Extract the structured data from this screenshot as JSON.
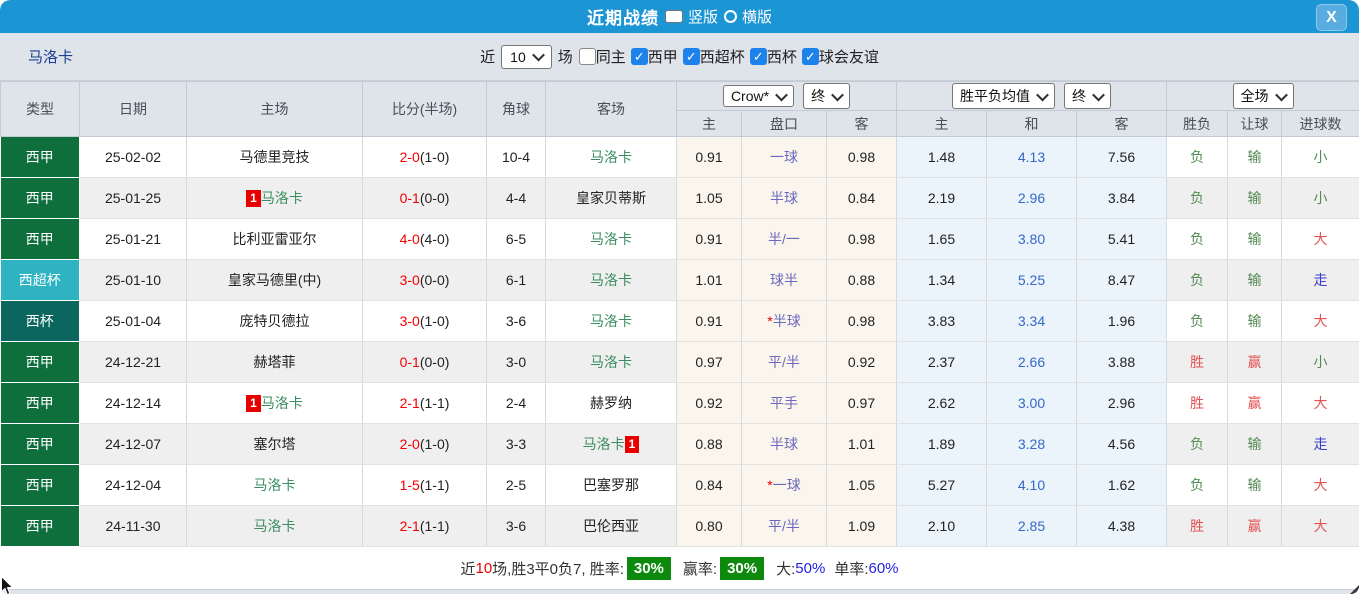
{
  "titlebar": {
    "title": "近期战绩",
    "view_options": [
      {
        "label": "竖版",
        "selected": true
      },
      {
        "label": "横版",
        "selected": false
      }
    ],
    "close_label": "X"
  },
  "filterbar": {
    "team": "马洛卡",
    "recent_label": "近",
    "recent_value": "10",
    "matches_label": "场",
    "filters": [
      {
        "label": "同主",
        "checked": false
      },
      {
        "label": "西甲",
        "checked": true
      },
      {
        "label": "西超杯",
        "checked": true
      },
      {
        "label": "西杯",
        "checked": true
      },
      {
        "label": "球会友谊",
        "checked": true
      }
    ]
  },
  "table": {
    "columns": [
      "类型",
      "日期",
      "主场",
      "比分(半场)",
      "角球",
      "客场"
    ],
    "selects": {
      "odds_company": "Crow*",
      "odds_time": "终",
      "avg_name": "胜平负均值",
      "avg_time": "终",
      "scope": "全场"
    },
    "sub_columns": [
      "主",
      "盘口",
      "客",
      "主",
      "和",
      "客",
      "胜负",
      "让球",
      "进球数"
    ],
    "rows": [
      {
        "league": "西甲",
        "date": "25-02-02",
        "home": {
          "name": "马德里竞技",
          "focus": false,
          "badge": null,
          "badge_after": false
        },
        "score": "2-0",
        "half": "(1-0)",
        "corners": "10-4",
        "away": {
          "name": "马洛卡",
          "focus": true,
          "badge": null,
          "badge_after": false
        },
        "crow": {
          "home": "0.91",
          "handicap": "一球",
          "star": false,
          "away": "0.98"
        },
        "avg": {
          "home": "1.48",
          "draw": "4.13",
          "away": "7.56"
        },
        "verdict": {
          "result": "负",
          "handicap": "输",
          "goals": "小"
        }
      },
      {
        "league": "西甲",
        "date": "25-01-25",
        "home": {
          "name": "马洛卡",
          "focus": true,
          "badge": "1",
          "badge_after": false
        },
        "score": "0-1",
        "half": "(0-0)",
        "corners": "4-4",
        "away": {
          "name": "皇家贝蒂斯",
          "focus": false,
          "badge": null,
          "badge_after": false
        },
        "crow": {
          "home": "1.05",
          "handicap": "半球",
          "star": false,
          "away": "0.84"
        },
        "avg": {
          "home": "2.19",
          "draw": "2.96",
          "away": "3.84"
        },
        "verdict": {
          "result": "负",
          "handicap": "输",
          "goals": "小"
        }
      },
      {
        "league": "西甲",
        "date": "25-01-21",
        "home": {
          "name": "比利亚雷亚尔",
          "focus": false,
          "badge": null,
          "badge_after": false
        },
        "score": "4-0",
        "half": "(4-0)",
        "corners": "6-5",
        "away": {
          "name": "马洛卡",
          "focus": true,
          "badge": null,
          "badge_after": false
        },
        "crow": {
          "home": "0.91",
          "handicap": "半/一",
          "star": false,
          "away": "0.98"
        },
        "avg": {
          "home": "1.65",
          "draw": "3.80",
          "away": "5.41"
        },
        "verdict": {
          "result": "负",
          "handicap": "输",
          "goals": "大"
        }
      },
      {
        "league": "西超杯",
        "date": "25-01-10",
        "home": {
          "name": "皇家马德里(中)",
          "focus": false,
          "badge": null,
          "badge_after": false
        },
        "score": "3-0",
        "half": "(0-0)",
        "corners": "6-1",
        "away": {
          "name": "马洛卡",
          "focus": true,
          "badge": null,
          "badge_after": false
        },
        "crow": {
          "home": "1.01",
          "handicap": "球半",
          "star": false,
          "away": "0.88"
        },
        "avg": {
          "home": "1.34",
          "draw": "5.25",
          "away": "8.47"
        },
        "verdict": {
          "result": "负",
          "handicap": "输",
          "goals": "走"
        }
      },
      {
        "league": "西杯",
        "date": "25-01-04",
        "home": {
          "name": "庞特贝德拉",
          "focus": false,
          "badge": null,
          "badge_after": false
        },
        "score": "3-0",
        "half": "(1-0)",
        "corners": "3-6",
        "away": {
          "name": "马洛卡",
          "focus": true,
          "badge": null,
          "badge_after": false
        },
        "crow": {
          "home": "0.91",
          "handicap": "半球",
          "star": true,
          "away": "0.98"
        },
        "avg": {
          "home": "3.83",
          "draw": "3.34",
          "away": "1.96"
        },
        "verdict": {
          "result": "负",
          "handicap": "输",
          "goals": "大"
        }
      },
      {
        "league": "西甲",
        "date": "24-12-21",
        "home": {
          "name": "赫塔菲",
          "focus": false,
          "badge": null,
          "badge_after": false
        },
        "score": "0-1",
        "half": "(0-0)",
        "corners": "3-0",
        "away": {
          "name": "马洛卡",
          "focus": true,
          "badge": null,
          "badge_after": false
        },
        "crow": {
          "home": "0.97",
          "handicap": "平/半",
          "star": false,
          "away": "0.92"
        },
        "avg": {
          "home": "2.37",
          "draw": "2.66",
          "away": "3.88"
        },
        "verdict": {
          "result": "胜",
          "handicap": "赢",
          "goals": "小"
        }
      },
      {
        "league": "西甲",
        "date": "24-12-14",
        "home": {
          "name": "马洛卡",
          "focus": true,
          "badge": "1",
          "badge_after": false
        },
        "score": "2-1",
        "half": "(1-1)",
        "corners": "2-4",
        "away": {
          "name": "赫罗纳",
          "focus": false,
          "badge": null,
          "badge_after": false
        },
        "crow": {
          "home": "0.92",
          "handicap": "平手",
          "star": false,
          "away": "0.97"
        },
        "avg": {
          "home": "2.62",
          "draw": "3.00",
          "away": "2.96"
        },
        "verdict": {
          "result": "胜",
          "handicap": "赢",
          "goals": "大"
        }
      },
      {
        "league": "西甲",
        "date": "24-12-07",
        "home": {
          "name": "塞尔塔",
          "focus": false,
          "badge": null,
          "badge_after": false
        },
        "score": "2-0",
        "half": "(1-0)",
        "corners": "3-3",
        "away": {
          "name": "马洛卡",
          "focus": true,
          "badge": "1",
          "badge_after": true
        },
        "crow": {
          "home": "0.88",
          "handicap": "半球",
          "star": false,
          "away": "1.01"
        },
        "avg": {
          "home": "1.89",
          "draw": "3.28",
          "away": "4.56"
        },
        "verdict": {
          "result": "负",
          "handicap": "输",
          "goals": "走"
        }
      },
      {
        "league": "西甲",
        "date": "24-12-04",
        "home": {
          "name": "马洛卡",
          "focus": true,
          "badge": null,
          "badge_after": false
        },
        "score": "1-5",
        "half": "(1-1)",
        "corners": "2-5",
        "away": {
          "name": "巴塞罗那",
          "focus": false,
          "badge": null,
          "badge_after": false
        },
        "crow": {
          "home": "0.84",
          "handicap": "一球",
          "star": true,
          "away": "1.05"
        },
        "avg": {
          "home": "5.27",
          "draw": "4.10",
          "away": "1.62"
        },
        "verdict": {
          "result": "负",
          "handicap": "输",
          "goals": "大"
        }
      },
      {
        "league": "西甲",
        "date": "24-11-30",
        "home": {
          "name": "马洛卡",
          "focus": true,
          "badge": null,
          "badge_after": false
        },
        "score": "2-1",
        "half": "(1-1)",
        "corners": "3-6",
        "away": {
          "name": "巴伦西亚",
          "focus": false,
          "badge": null,
          "badge_after": false
        },
        "crow": {
          "home": "0.80",
          "handicap": "平/半",
          "star": false,
          "away": "1.09"
        },
        "avg": {
          "home": "2.10",
          "draw": "2.85",
          "away": "4.38"
        },
        "verdict": {
          "result": "胜",
          "handicap": "赢",
          "goals": "大"
        }
      }
    ]
  },
  "summary": {
    "recent_label": "近",
    "recent_count": "10",
    "stats_text": "场,胜3平0负7, 胜率:",
    "win_rate": "30%",
    "win_odds_label": "赢率:",
    "win_odds_rate": "30%",
    "big_label": "大:",
    "big_rate": "50%",
    "single_label": "单率:",
    "single_rate": "60%"
  },
  "colors": {
    "league": {
      "西甲": "#0e6e3c",
      "西超杯": "#2fb3c3",
      "西杯": "#0b665f"
    },
    "verdict": {
      "胜": "#e25252",
      "负": "#538b52",
      "赢": "#e25252",
      "输": "#538b52",
      "大": "#e25252",
      "小": "#538b52",
      "走": "#3b3bd0"
    },
    "accent_blue": "#1b95d3",
    "badge_red": "#e60000",
    "rate_green": "#0d8a0d"
  }
}
